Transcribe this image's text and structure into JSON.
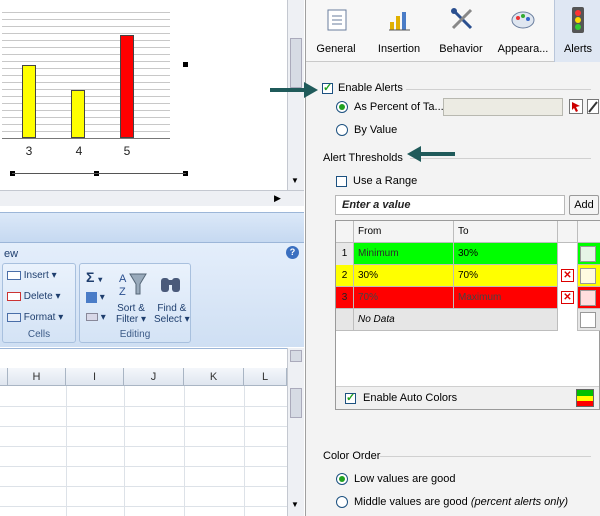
{
  "chart": {
    "x_labels": [
      "3",
      "4",
      "5"
    ],
    "values": [
      58,
      38,
      82
    ],
    "ymax": 100,
    "colors": [
      "#ffff00",
      "#ffff00",
      "#ff0000"
    ]
  },
  "ribbon": {
    "tab_fragment": "ew",
    "help": "?",
    "cells": {
      "insert": "Insert",
      "delete": "Delete",
      "format": "Format",
      "group": "Cells"
    },
    "editing": {
      "sigma": "Σ",
      "sort": "Sort &",
      "filter": "Filter",
      "find": "Find &",
      "select": "Select",
      "group": "Editing"
    }
  },
  "sheet": {
    "columns": [
      "H",
      "I",
      "J",
      "K",
      "L"
    ]
  },
  "panel": {
    "tabs": [
      {
        "label": "General",
        "icon": "general-icon"
      },
      {
        "label": "Insertion",
        "icon": "insertion-icon"
      },
      {
        "label": "Behavior",
        "icon": "behavior-icon"
      },
      {
        "label": "Appeara...",
        "icon": "appearance-icon"
      },
      {
        "label": "Alerts",
        "icon": "alerts-icon"
      }
    ],
    "enable_alerts": "Enable Alerts",
    "as_percent": "As Percent of Ta...",
    "by_value": "By Value",
    "alert_thresholds": "Alert Thresholds",
    "use_range": "Use a Range",
    "enter_value_placeholder": "Enter a value",
    "add": "Add",
    "table": {
      "headers": [
        "From",
        "To"
      ],
      "rows": [
        {
          "num": "1",
          "from": "Minimum",
          "to": "30%",
          "color": "#00ff00"
        },
        {
          "num": "2",
          "from": "30%",
          "to": "70%",
          "color": "#ffff00"
        },
        {
          "num": "3",
          "from": "70%",
          "to": "Maximum",
          "color": "#ff0000"
        }
      ],
      "no_data": "No Data"
    },
    "enable_auto_colors": "Enable Auto Colors",
    "color_order": "Color Order",
    "low_good": "Low values are good",
    "middle_good": "Middle values are good",
    "middle_note": "(percent alerts only)"
  }
}
